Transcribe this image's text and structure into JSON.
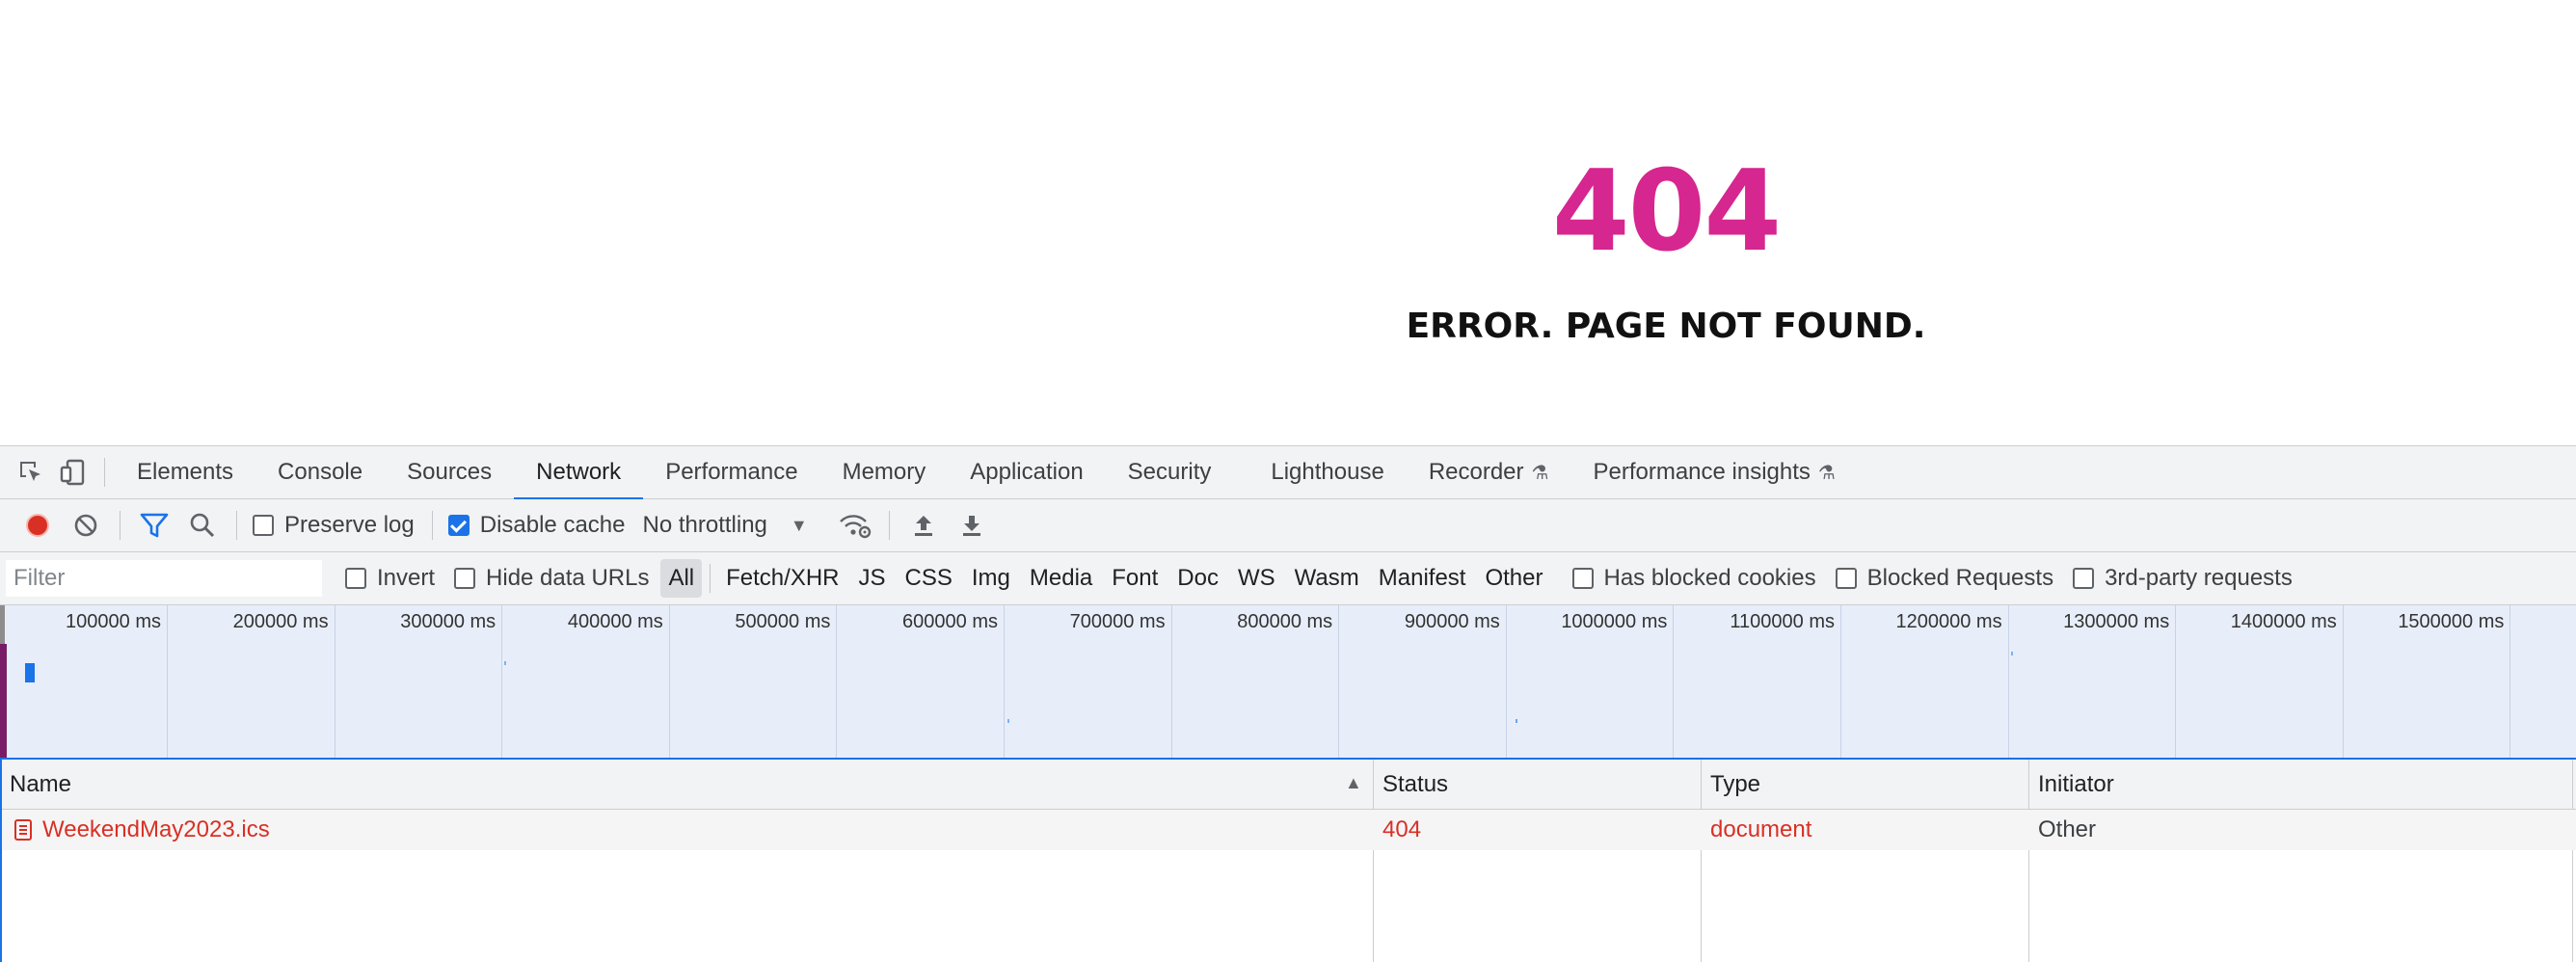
{
  "page": {
    "error_code": "404",
    "error_message": "ERROR. PAGE NOT FOUND.",
    "accent_color": "#d6268f"
  },
  "devtools": {
    "tabs": [
      {
        "label": "Elements"
      },
      {
        "label": "Console"
      },
      {
        "label": "Sources"
      },
      {
        "label": "Network",
        "active": true
      },
      {
        "label": "Performance"
      },
      {
        "label": "Memory"
      },
      {
        "label": "Application"
      },
      {
        "label": "Security"
      },
      {
        "label": "Lighthouse"
      },
      {
        "label": "Recorder",
        "experimental": true
      },
      {
        "label": "Performance insights",
        "experimental": true
      }
    ],
    "toolbar": {
      "preserve_log_label": "Preserve log",
      "preserve_log_checked": false,
      "disable_cache_label": "Disable cache",
      "disable_cache_checked": true,
      "throttling_value": "No throttling"
    },
    "filterbar": {
      "filter_placeholder": "Filter",
      "invert_label": "Invert",
      "hide_data_urls_label": "Hide data URLs",
      "types": [
        "All",
        "Fetch/XHR",
        "JS",
        "CSS",
        "Img",
        "Media",
        "Font",
        "Doc",
        "WS",
        "Wasm",
        "Manifest",
        "Other"
      ],
      "selected_type": "All",
      "has_blocked_cookies_label": "Has blocked cookies",
      "blocked_requests_label": "Blocked Requests",
      "third_party_label": "3rd-party requests"
    },
    "overview": {
      "ticks": [
        "100000 ms",
        "200000 ms",
        "300000 ms",
        "400000 ms",
        "500000 ms",
        "600000 ms",
        "700000 ms",
        "800000 ms",
        "900000 ms",
        "1000000 ms",
        "1100000 ms",
        "1200000 ms",
        "1300000 ms",
        "1400000 ms",
        "1500000 ms"
      ]
    },
    "table": {
      "columns": {
        "name": "Name",
        "status": "Status",
        "type": "Type",
        "initiator": "Initiator"
      },
      "rows": [
        {
          "name": "WeekendMay2023.ics",
          "status": "404",
          "type": "document",
          "initiator": "Other"
        }
      ]
    },
    "colors": {
      "accent_blue": "#1a73e8",
      "error_red": "#d93025",
      "record_red": "#d93025"
    }
  }
}
